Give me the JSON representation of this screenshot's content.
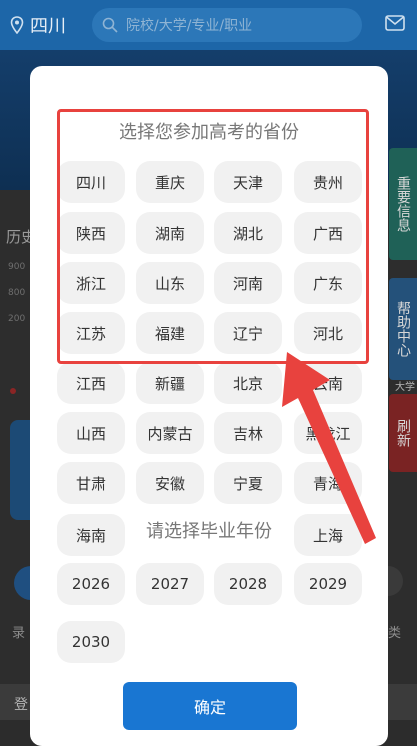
{
  "topbar": {
    "location": "四川",
    "search_placeholder": "院校/大学/专业/职业",
    "location_icon": "location-pin-icon",
    "mail_icon": "mail-icon"
  },
  "background": {
    "history_label": "历史",
    "ticks": [
      "900",
      "800",
      "200"
    ],
    "left_bottom_label": "录",
    "right_bottom_label": "类",
    "bottom_bar_label": "登",
    "side_small": "大学"
  },
  "side_tabs": {
    "important": "重要信息",
    "help": "帮助中心",
    "refresh": "刷新"
  },
  "modal": {
    "province_title": "选择您参加高考的省份",
    "year_title": "请选择毕业年份",
    "provinces": [
      "四川",
      "重庆",
      "天津",
      "贵州",
      "陕西",
      "湖南",
      "湖北",
      "广西",
      "浙江",
      "山东",
      "河南",
      "广东",
      "江苏",
      "福建",
      "辽宁",
      "河北",
      "江西",
      "新疆",
      "北京",
      "云南",
      "山西",
      "内蒙古",
      "吉林",
      "黑龙江",
      "甘肃",
      "安徽",
      "宁夏",
      "青海",
      "海南",
      "",
      "",
      "上海"
    ],
    "years": [
      "2026",
      "2027",
      "2028",
      "2029",
      "2030"
    ],
    "confirm_label": "确定"
  },
  "colors": {
    "highlight": "#e8423e",
    "primary": "#1976d2"
  }
}
